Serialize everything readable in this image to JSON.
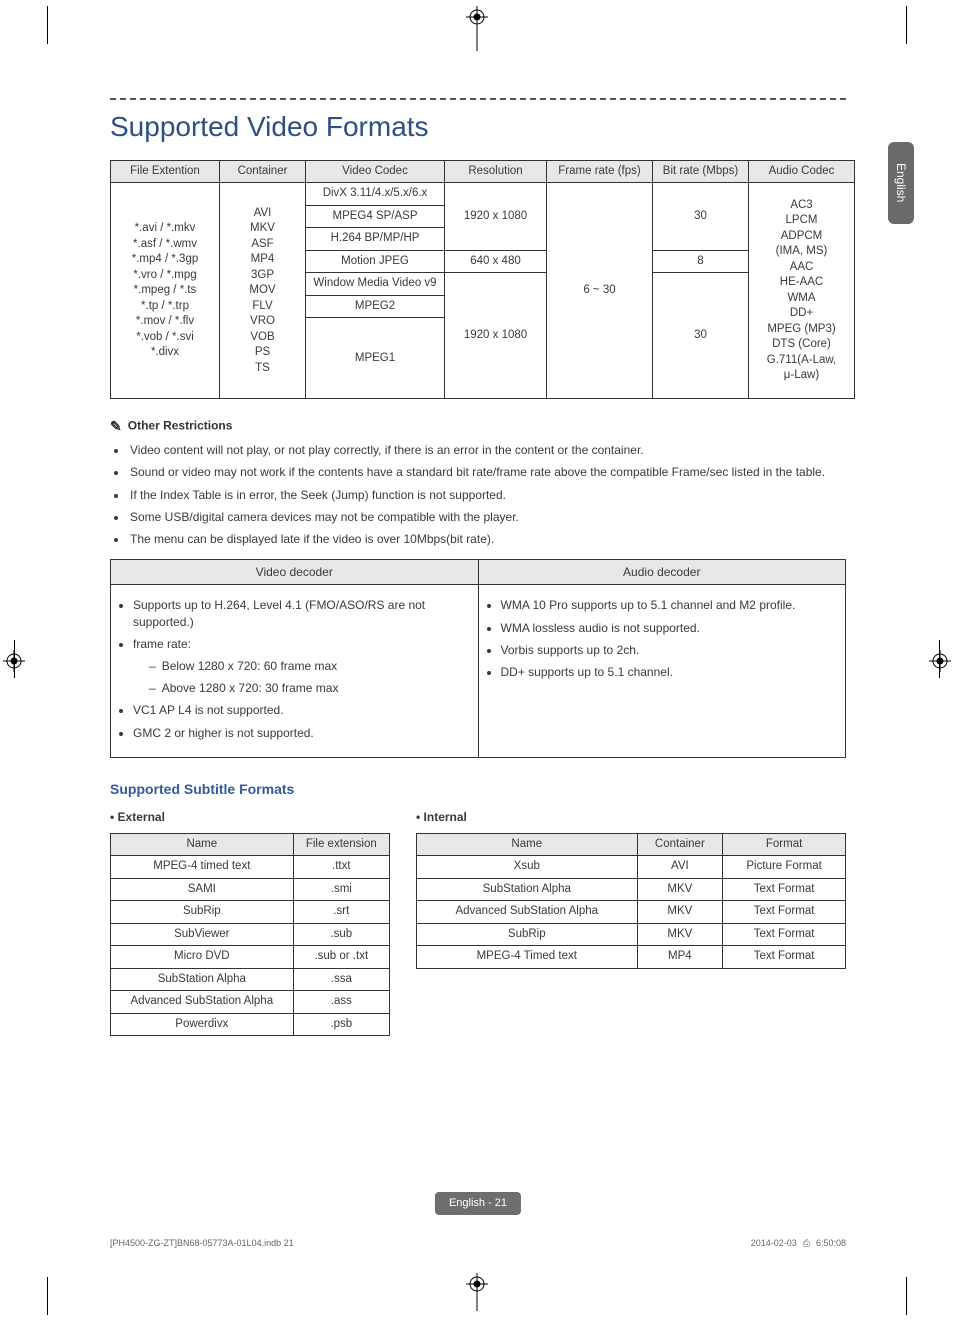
{
  "lang_tab": "English",
  "title": "Supported Video Formats",
  "section_other_restrictions": "Other Restrictions",
  "restrictions": [
    "Video content will not play, or not play correctly, if there is an error in the content or the container.",
    "Sound or video may not work if the contents have a standard bit rate/frame rate above the compatible Frame/sec listed in the table.",
    "If the Index Table is in error, the Seek (Jump) function is not supported.",
    "Some USB/digital camera devices may not be compatible with the player.",
    "The menu can be displayed late if the video is over 10Mbps(bit rate)."
  ],
  "main_table": {
    "headers": [
      "File Extention",
      "Container",
      "Video Codec",
      "Resolution",
      "Frame rate (fps)",
      "Bit rate (Mbps)",
      "Audio Codec"
    ],
    "file_ext": "*.avi / *.mkv\n*.asf / *.wmv\n*.mp4 / *.3gp\n*.vro / *.mpg\n*.mpeg / *.ts\n*.tp / *.trp\n*.mov / *.flv\n*.vob / *.svi\n*.divx",
    "container": "AVI\nMKV\nASF\nMP4\n3GP\nMOV\nFLV\nVRO\nVOB\nPS\nTS",
    "codecs_top": [
      "DivX 3.11/4.x/5.x/6.x",
      "MPEG4 SP/ASP",
      "H.264 BP/MP/HP"
    ],
    "codec_mj": "Motion JPEG",
    "codecs_bot": [
      "Window Media Video v9",
      "MPEG2"
    ],
    "codec_mpeg1": "MPEG1",
    "res_top": "1920 x 1080",
    "res_mj": "640 x 480",
    "res_bot": "1920 x 1080",
    "frame_rate": "6 ~ 30",
    "bitrate_top": "30",
    "bitrate_mj": "8",
    "bitrate_bot": "30",
    "audio_codec": "AC3\nLPCM\nADPCM\n(IMA, MS)\nAAC\nHE-AAC\nWMA\nDD+\nMPEG (MP3)\nDTS (Core)\nG.711(A-Law,\nμ-Law)"
  },
  "decoder_table": {
    "headers": [
      "Video decoder",
      "Audio decoder"
    ],
    "video": {
      "i0": "Supports up to H.264, Level 4.1 (FMO/ASO/RS are not supported.)",
      "i1": "frame rate:",
      "i1a": "Below 1280 x 720: 60 frame max",
      "i1b": "Above 1280 x 720: 30 frame max",
      "i2": "VC1 AP L4 is not supported.",
      "i3": "GMC 2 or higher is not supported."
    },
    "audio": {
      "i0": "WMA 10 Pro supports up to 5.1 channel and M2 profile.",
      "i1": "WMA lossless audio is not supported.",
      "i2": "Vorbis supports up to 2ch.",
      "i3": "DD+ supports up to 5.1 channel."
    }
  },
  "subtitle_section_title": "Supported Subtitle Formats",
  "external": {
    "label": "External",
    "headers": [
      "Name",
      "File extension"
    ],
    "rows": [
      [
        "MPEG-4 timed text",
        ".ttxt"
      ],
      [
        "SAMI",
        ".smi"
      ],
      [
        "SubRip",
        ".srt"
      ],
      [
        "SubViewer",
        ".sub"
      ],
      [
        "Micro DVD",
        ".sub or .txt"
      ],
      [
        "SubStation Alpha",
        ".ssa"
      ],
      [
        "Advanced SubStation Alpha",
        ".ass"
      ],
      [
        "Powerdivx",
        ".psb"
      ]
    ]
  },
  "internal": {
    "label": "Internal",
    "headers": [
      "Name",
      "Container",
      "Format"
    ],
    "rows": [
      [
        "Xsub",
        "AVI",
        "Picture Format"
      ],
      [
        "SubStation Alpha",
        "MKV",
        "Text Format"
      ],
      [
        "Advanced SubStation Alpha",
        "MKV",
        "Text Format"
      ],
      [
        "SubRip",
        "MKV",
        "Text Format"
      ],
      [
        "MPEG-4 Timed text",
        "MP4",
        "Text Format"
      ]
    ]
  },
  "footer": {
    "page_label": "English - 21",
    "indb": "[PH4500-ZG-ZT]BN68-05773A-01L04.indb   21",
    "date": "2014-02-03",
    "time": "6:50:08",
    "time_icon": "⎙"
  }
}
